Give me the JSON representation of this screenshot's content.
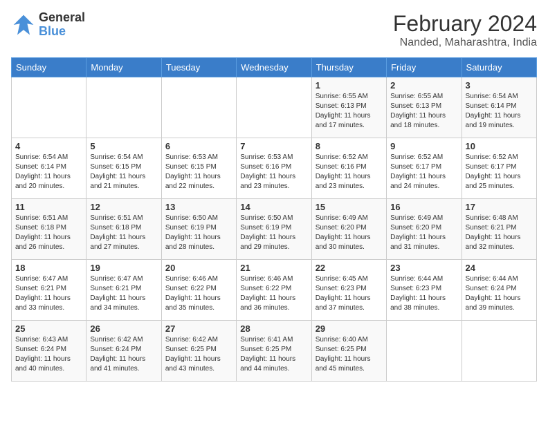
{
  "logo": {
    "line1": "General",
    "line2": "Blue"
  },
  "title": "February 2024",
  "subtitle": "Nanded, Maharashtra, India",
  "days_of_week": [
    "Sunday",
    "Monday",
    "Tuesday",
    "Wednesday",
    "Thursday",
    "Friday",
    "Saturday"
  ],
  "weeks": [
    [
      {
        "day": "",
        "info": ""
      },
      {
        "day": "",
        "info": ""
      },
      {
        "day": "",
        "info": ""
      },
      {
        "day": "",
        "info": ""
      },
      {
        "day": "1",
        "info": "Sunrise: 6:55 AM\nSunset: 6:13 PM\nDaylight: 11 hours\nand 17 minutes."
      },
      {
        "day": "2",
        "info": "Sunrise: 6:55 AM\nSunset: 6:13 PM\nDaylight: 11 hours\nand 18 minutes."
      },
      {
        "day": "3",
        "info": "Sunrise: 6:54 AM\nSunset: 6:14 PM\nDaylight: 11 hours\nand 19 minutes."
      }
    ],
    [
      {
        "day": "4",
        "info": "Sunrise: 6:54 AM\nSunset: 6:14 PM\nDaylight: 11 hours\nand 20 minutes."
      },
      {
        "day": "5",
        "info": "Sunrise: 6:54 AM\nSunset: 6:15 PM\nDaylight: 11 hours\nand 21 minutes."
      },
      {
        "day": "6",
        "info": "Sunrise: 6:53 AM\nSunset: 6:15 PM\nDaylight: 11 hours\nand 22 minutes."
      },
      {
        "day": "7",
        "info": "Sunrise: 6:53 AM\nSunset: 6:16 PM\nDaylight: 11 hours\nand 23 minutes."
      },
      {
        "day": "8",
        "info": "Sunrise: 6:52 AM\nSunset: 6:16 PM\nDaylight: 11 hours\nand 23 minutes."
      },
      {
        "day": "9",
        "info": "Sunrise: 6:52 AM\nSunset: 6:17 PM\nDaylight: 11 hours\nand 24 minutes."
      },
      {
        "day": "10",
        "info": "Sunrise: 6:52 AM\nSunset: 6:17 PM\nDaylight: 11 hours\nand 25 minutes."
      }
    ],
    [
      {
        "day": "11",
        "info": "Sunrise: 6:51 AM\nSunset: 6:18 PM\nDaylight: 11 hours\nand 26 minutes."
      },
      {
        "day": "12",
        "info": "Sunrise: 6:51 AM\nSunset: 6:18 PM\nDaylight: 11 hours\nand 27 minutes."
      },
      {
        "day": "13",
        "info": "Sunrise: 6:50 AM\nSunset: 6:19 PM\nDaylight: 11 hours\nand 28 minutes."
      },
      {
        "day": "14",
        "info": "Sunrise: 6:50 AM\nSunset: 6:19 PM\nDaylight: 11 hours\nand 29 minutes."
      },
      {
        "day": "15",
        "info": "Sunrise: 6:49 AM\nSunset: 6:20 PM\nDaylight: 11 hours\nand 30 minutes."
      },
      {
        "day": "16",
        "info": "Sunrise: 6:49 AM\nSunset: 6:20 PM\nDaylight: 11 hours\nand 31 minutes."
      },
      {
        "day": "17",
        "info": "Sunrise: 6:48 AM\nSunset: 6:21 PM\nDaylight: 11 hours\nand 32 minutes."
      }
    ],
    [
      {
        "day": "18",
        "info": "Sunrise: 6:47 AM\nSunset: 6:21 PM\nDaylight: 11 hours\nand 33 minutes."
      },
      {
        "day": "19",
        "info": "Sunrise: 6:47 AM\nSunset: 6:21 PM\nDaylight: 11 hours\nand 34 minutes."
      },
      {
        "day": "20",
        "info": "Sunrise: 6:46 AM\nSunset: 6:22 PM\nDaylight: 11 hours\nand 35 minutes."
      },
      {
        "day": "21",
        "info": "Sunrise: 6:46 AM\nSunset: 6:22 PM\nDaylight: 11 hours\nand 36 minutes."
      },
      {
        "day": "22",
        "info": "Sunrise: 6:45 AM\nSunset: 6:23 PM\nDaylight: 11 hours\nand 37 minutes."
      },
      {
        "day": "23",
        "info": "Sunrise: 6:44 AM\nSunset: 6:23 PM\nDaylight: 11 hours\nand 38 minutes."
      },
      {
        "day": "24",
        "info": "Sunrise: 6:44 AM\nSunset: 6:24 PM\nDaylight: 11 hours\nand 39 minutes."
      }
    ],
    [
      {
        "day": "25",
        "info": "Sunrise: 6:43 AM\nSunset: 6:24 PM\nDaylight: 11 hours\nand 40 minutes."
      },
      {
        "day": "26",
        "info": "Sunrise: 6:42 AM\nSunset: 6:24 PM\nDaylight: 11 hours\nand 41 minutes."
      },
      {
        "day": "27",
        "info": "Sunrise: 6:42 AM\nSunset: 6:25 PM\nDaylight: 11 hours\nand 43 minutes."
      },
      {
        "day": "28",
        "info": "Sunrise: 6:41 AM\nSunset: 6:25 PM\nDaylight: 11 hours\nand 44 minutes."
      },
      {
        "day": "29",
        "info": "Sunrise: 6:40 AM\nSunset: 6:25 PM\nDaylight: 11 hours\nand 45 minutes."
      },
      {
        "day": "",
        "info": ""
      },
      {
        "day": "",
        "info": ""
      }
    ]
  ]
}
